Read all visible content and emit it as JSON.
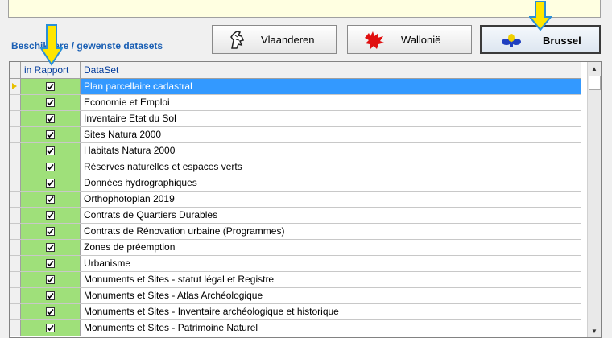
{
  "header": {
    "label": "Beschikbare / gewenste datasets"
  },
  "regions": [
    {
      "label": "Vlaanderen",
      "active": false
    },
    {
      "label": "Wallonië",
      "active": false
    },
    {
      "label": "Brussel",
      "active": true
    }
  ],
  "grid": {
    "columns": [
      "in Rapport",
      "DataSet"
    ],
    "rows": [
      {
        "dataset": "Plan parcellaire cadastral",
        "checked": true,
        "selected": true
      },
      {
        "dataset": "Economie et Emploi",
        "checked": true
      },
      {
        "dataset": "Inventaire Etat du Sol",
        "checked": true
      },
      {
        "dataset": "Sites Natura 2000",
        "checked": true
      },
      {
        "dataset": "Habitats Natura 2000",
        "checked": true
      },
      {
        "dataset": "Réserves naturelles et espaces verts",
        "checked": true
      },
      {
        "dataset": "Données hydrographiques",
        "checked": true
      },
      {
        "dataset": "Orthophotoplan 2019",
        "checked": true
      },
      {
        "dataset": "Contrats de Quartiers Durables",
        "checked": true
      },
      {
        "dataset": "Contrats de Rénovation urbaine (Programmes)",
        "checked": true
      },
      {
        "dataset": "Zones de préemption",
        "checked": true
      },
      {
        "dataset": "Urbanisme",
        "checked": true
      },
      {
        "dataset": "Monuments et Sites - statut légal et Registre",
        "checked": true
      },
      {
        "dataset": "Monuments et Sites - Atlas Archéologique",
        "checked": true
      },
      {
        "dataset": "Monuments et Sites - Inventaire archéologique et historique",
        "checked": true
      },
      {
        "dataset": "Monuments et Sites - Patrimoine Naturel",
        "checked": true
      }
    ]
  },
  "colors": {
    "selection": "#3399ff",
    "check_column": "#9fe07a",
    "header_text": "#1a5fb4",
    "annotation_arrow": "#ffe600"
  },
  "icons": [
    "flanders-lion-icon",
    "wallonia-rooster-icon",
    "brussels-iris-icon",
    "annotation-arrow-icon"
  ]
}
